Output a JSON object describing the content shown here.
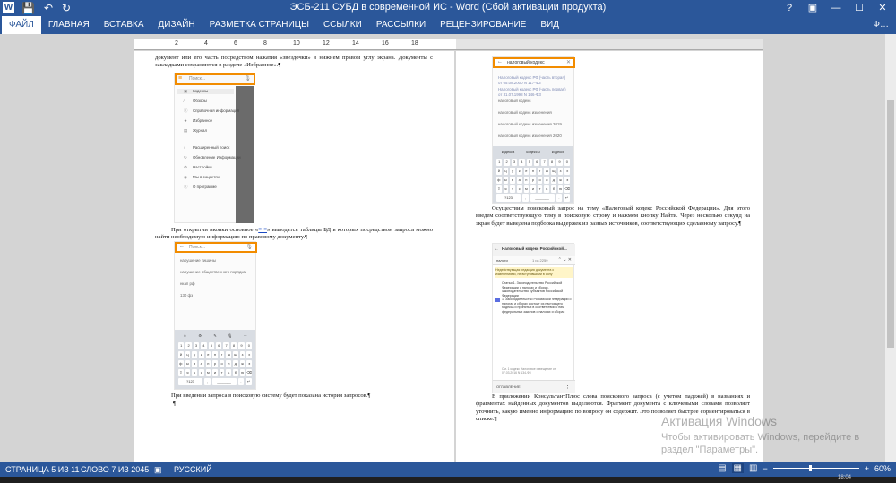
{
  "window": {
    "title": "ЭСБ-211 СУБД в современной ИС - Word (Сбой активации продукта)",
    "app_icon": "W",
    "controls": {
      "help": "?",
      "restore": "▣",
      "minimize": "—",
      "maximize": "☐",
      "close": "✕"
    }
  },
  "qat": {
    "save": "💾",
    "undo": "↶",
    "redo": "↻"
  },
  "ribbon": {
    "tabs": [
      "ФАЙЛ",
      "ГЛАВНАЯ",
      "ВСТАВКА",
      "ДИЗАЙН",
      "РАЗМЕТКА СТРАНИЦЫ",
      "ССЫЛКИ",
      "РАССЫЛКИ",
      "РЕЦЕНЗИРОВАНИЕ",
      "ВИД"
    ],
    "active": 0,
    "user": "Ф…"
  },
  "ruler": {
    "ticks": [
      "2",
      "4",
      "6",
      "8",
      "10",
      "12",
      "14",
      "16",
      "18"
    ]
  },
  "left_page": {
    "para1": "документ или его часть посредством нажатия «звездочки» в нижнем правом углу экрана. Документы с закладками сохраняются в разделе «Избранное».¶",
    "shot1": {
      "search_placeholder": "Поиск...",
      "items": [
        "Кодексы",
        "Обзоры",
        "Справочная информация",
        "Избранное",
        "Журнал",
        "Расширенный поиск",
        "Обновление Информации",
        "Настройки",
        "Мы в соцсетях",
        "О программе"
      ]
    },
    "para2": "При открытии иконки основное «",
    "para2_link": "≡ ≡",
    "para2_rest": "» выводятся таблицы БД в которых посредством запроса можно найти необходимую информацию по правовому документу.¶",
    "shot2": {
      "search_placeholder": "Поиск...",
      "history": [
        "нарушение тишины",
        "нарушение общественного порядка",
        "нкап рф",
        "130 фз"
      ],
      "key_rows": [
        [
          "1",
          "2",
          "3",
          "4",
          "5",
          "6",
          "7",
          "8",
          "9",
          "0"
        ],
        [
          "й",
          "ц",
          "у",
          "к",
          "е",
          "н",
          "г",
          "ш",
          "щ",
          "з",
          "х"
        ],
        [
          "ф",
          "ы",
          "в",
          "а",
          "п",
          "р",
          "о",
          "л",
          "д",
          "ж",
          "э"
        ],
        [
          "⇧",
          "я",
          "ч",
          "с",
          "м",
          "и",
          "т",
          "ь",
          "б",
          "ю",
          "⌫"
        ],
        [
          "?123",
          ",",
          "_______",
          ".",
          "↵"
        ]
      ]
    },
    "para3": "При введении запроса в поисковую систему будет показана история запросов.¶",
    "para4": "¶"
  },
  "right_page": {
    "shot3": {
      "query": "налоговый кодекс",
      "results": [
        "Налоговый кодекс РФ (часть вторая) от 05.08.2000 N 117-ФЗ",
        "Налоговый кодекс РФ (часть первая) от 31.07.1998 N 146-ФЗ",
        "налоговый кодекс",
        "налоговый кодекс изменения",
        "налоговый кодекс изменения 2019",
        "налоговый кодекс изменения 2020"
      ],
      "suggest": [
        "кодекса",
        "кодексы",
        "кодексе"
      ],
      "key_rows": [
        [
          "1",
          "2",
          "3",
          "4",
          "5",
          "6",
          "7",
          "8",
          "9",
          "0"
        ],
        [
          "й",
          "ц",
          "у",
          "к",
          "е",
          "н",
          "г",
          "ш",
          "щ",
          "з",
          "х"
        ],
        [
          "ф",
          "ы",
          "в",
          "а",
          "п",
          "р",
          "о",
          "л",
          "д",
          "ж",
          "э"
        ],
        [
          "⇧",
          "я",
          "ч",
          "с",
          "м",
          "и",
          "т",
          "ь",
          "б",
          "ю",
          "⌫"
        ],
        [
          "?123",
          ",",
          "_______",
          ".",
          "↵"
        ]
      ]
    },
    "para1": "Осуществим поисковый запрос на тему «Налоговый кодекс Российской Федерации». Для этого введем соответствующую тему в поисковую строку и нажмем кнопку Найти. Через несколько секунд на экран будет выведена подборка выдержек из разных источников, соответствующих сделанному запросу.¶",
    "shot4": {
      "header": "Налоговый кодекс Российской...",
      "search": "налоги",
      "counter": "1 из 2259",
      "notice": "Недействующая редакция документа с изменениями, не вступившими в силу",
      "art1": "Статья 1. Законодательство Российской Федерации о налогах и сборах, законодательство субъектов Российской Федерации",
      "art2": "1. Законодательство Российской Федерации о налогах и сборах состоит из настоящего Кодекса и принятых в соответствии с ним федеральных законов о налогах и сборах",
      "date": "См. 1 кодекс Налоговое извещение от 07.03.2016 N 134-ФЗ",
      "bottom": "ОГЛАВЛЕНИЕ"
    },
    "para2": "В приложении КонсультантПлюс слова поискового запроса (с учетом падежей) в названиях и фрагментах найденных документов выделяются. Фрагмент документа с ключевыми словами позволяет уточнить, какую именно информацию по вопросу он содержит. Это позволяет быстрее сориентироваться в списке.¶"
  },
  "watermark": {
    "line1": "Активация Windows",
    "line2": "Чтобы активировать Windows, перейдите в раздел \"Параметры\"."
  },
  "status": {
    "page": "СТРАНИЦА 5 ИЗ 11",
    "words": "СЛОВО 7 ИЗ 2045",
    "lang": "РУССКИЙ",
    "zoom": "60%",
    "zoom_fraction": 0.42
  },
  "taskbar": {
    "clock": "18:04"
  }
}
